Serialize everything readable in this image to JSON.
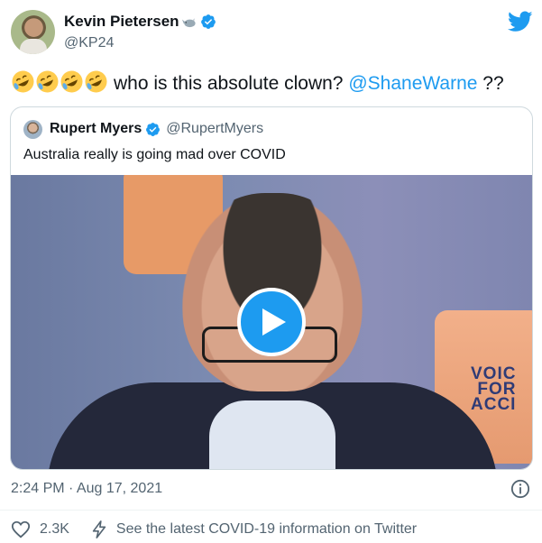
{
  "author": {
    "display_name": "Kevin Pietersen",
    "name_emoji": "rhino-emoji",
    "verified_icon": "verified-badge-icon",
    "handle": "@KP24"
  },
  "brand": {
    "logo": "twitter-bird-icon",
    "color": "#1d9bf0"
  },
  "tweet": {
    "emojis": [
      "rofl-emoji",
      "rofl-emoji",
      "rofl-emoji",
      "rofl-emoji"
    ],
    "text_before": "who is this absolute clown?",
    "mention": "@ShaneWarne",
    "text_after": "??"
  },
  "quoted_tweet": {
    "display_name": "Rupert Myers",
    "verified_icon": "verified-badge-icon",
    "handle": "@RupertMyers",
    "text": "Australia really is going mad over COVID",
    "media": {
      "type": "video",
      "play_icon": "play-icon",
      "poster_text": [
        "VOIC",
        "FOR",
        "ACCI"
      ]
    }
  },
  "timestamp": "2:24 PM · Aug 17, 2021",
  "info_icon": "info-icon",
  "footer": {
    "like_icon": "heart-icon",
    "like_count": "2.3K",
    "covid_icon": "lightning-icon",
    "covid_link": "See the latest COVID-19 information on Twitter"
  },
  "colors": {
    "text_primary": "#0f1419",
    "text_secondary": "#536471",
    "accent": "#1d9bf0",
    "border": "#cfd9de"
  }
}
